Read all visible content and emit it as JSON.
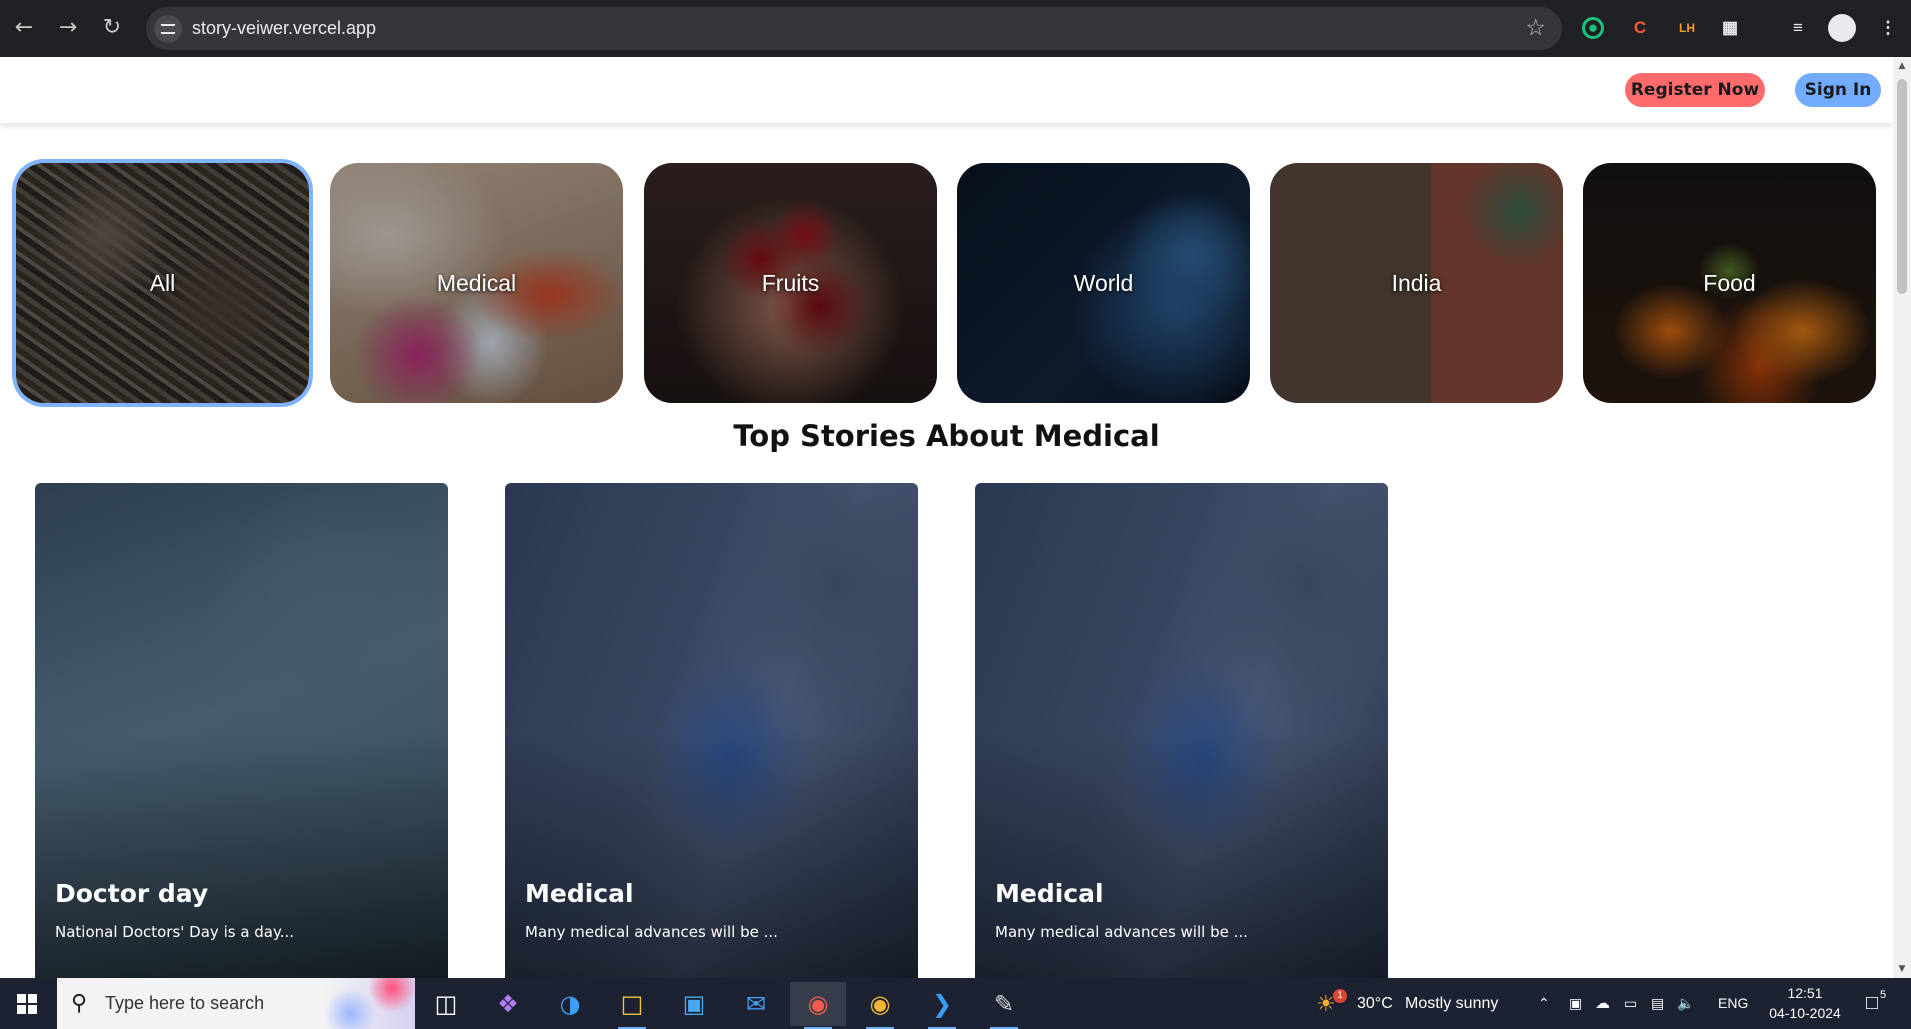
{
  "browser": {
    "url": "story-veiwer.vercel.app",
    "back_icon": "arrow-left-icon",
    "forward_icon": "arrow-right-icon",
    "reload_icon": "reload-icon"
  },
  "header": {
    "register_label": "Register Now",
    "signin_label": "Sign In",
    "register_color": "#ff6b6b",
    "signin_color": "#73abff"
  },
  "categories": [
    {
      "label": "All",
      "selected": true
    },
    {
      "label": "Medical",
      "selected": false
    },
    {
      "label": "Fruits",
      "selected": false
    },
    {
      "label": "World",
      "selected": false
    },
    {
      "label": "India",
      "selected": false
    },
    {
      "label": "Food",
      "selected": false
    }
  ],
  "section_title": "Top Stories About Medical",
  "stories": [
    {
      "title": "Doctor day",
      "description": "National Doctors' Day is a day..."
    },
    {
      "title": "Medical",
      "description": "Many medical advances will be ..."
    },
    {
      "title": "Medical",
      "description": "Many medical advances will be ..."
    }
  ],
  "taskbar": {
    "search_placeholder": "Type here to search",
    "weather_temp": "30°C",
    "weather_text": "Mostly sunny",
    "weather_badge": "1",
    "language": "ENG",
    "time": "12:51",
    "date": "04-10-2024",
    "notification_count": "5"
  }
}
